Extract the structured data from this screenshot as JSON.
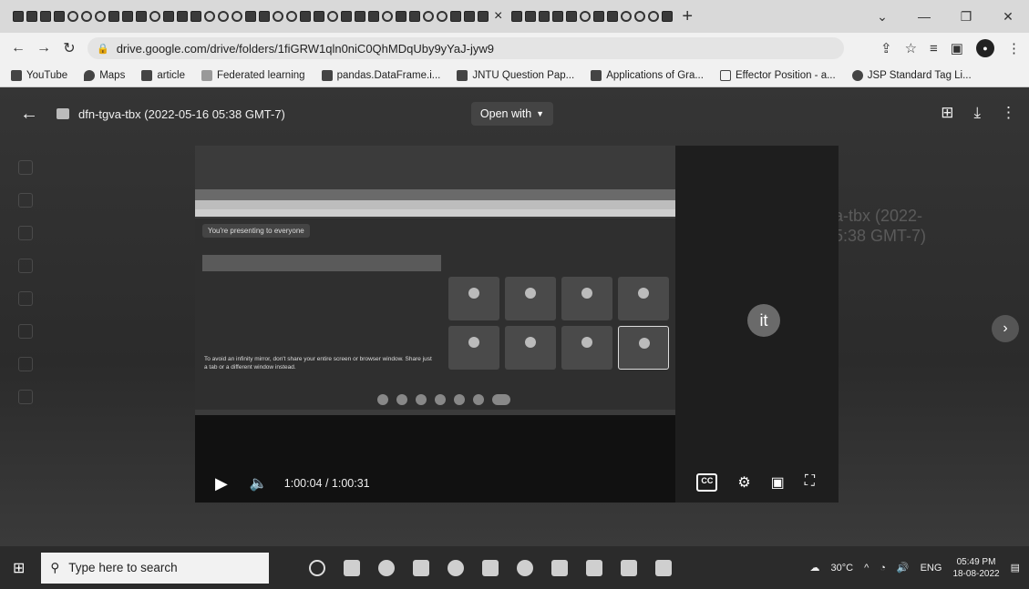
{
  "browser": {
    "tab_close": "×",
    "new_tab": "+",
    "url": "drive.google.com/drive/folders/1fiGRW1qln0niC0QhMDqUby9yYaJ-jyw9",
    "bookmarks": [
      {
        "label": "YouTube",
        "icon": "youtube-icon"
      },
      {
        "label": "Maps",
        "icon": "maps-icon"
      },
      {
        "label": "article",
        "icon": "article-icon"
      },
      {
        "label": "Federated learning",
        "icon": "folder-icon"
      },
      {
        "label": "pandas.DataFrame.i...",
        "icon": "pandas-icon"
      },
      {
        "label": "JNTU Question Pap...",
        "icon": "jntu-icon"
      },
      {
        "label": "Applications of Gra...",
        "icon": "doc-icon"
      },
      {
        "label": "Effector Position - a...",
        "icon": "effector-icon"
      },
      {
        "label": "JSP Standard Tag Li...",
        "icon": "globe-icon"
      }
    ]
  },
  "viewer": {
    "filename": "dfn-tgva-tbx (2022-05-16 05:38 GMT-7)",
    "open_with": "Open with",
    "ghost_right_text": "a-tbx (2022-\n5:38 GMT-7)"
  },
  "inner_meet": {
    "presenting": "You're presenting to everyone",
    "banner": "To avoid an infinity mirror, don't share your entire screen or browser window. Share just a tab or a different window instead."
  },
  "player": {
    "time": "1:00:04 / 1:00:31",
    "avatar_letter": "it",
    "cc": "CC"
  },
  "taskbar": {
    "search_placeholder": "Type here to search",
    "temperature": "30°C",
    "language": "ENG",
    "time": "05:49 PM",
    "date": "18-08-2022"
  }
}
